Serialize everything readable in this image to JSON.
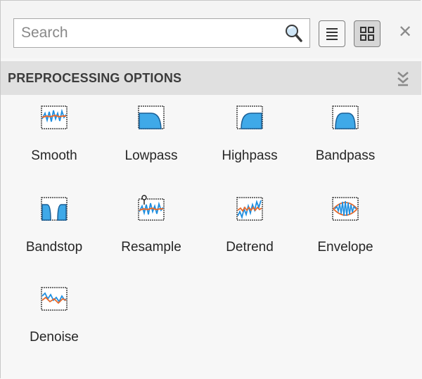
{
  "search": {
    "placeholder": "Search",
    "value": ""
  },
  "toolbar": {
    "list_view_icon": "list-view-icon",
    "grid_view_icon": "grid-view-icon",
    "close_glyph": "✕",
    "active_view": "grid"
  },
  "section": {
    "title": "PREPROCESSING OPTIONS",
    "collapse_icon": "collapse-chevrons-icon"
  },
  "options": [
    {
      "label": "Smooth",
      "icon": "smooth-icon"
    },
    {
      "label": "Lowpass",
      "icon": "lowpass-icon"
    },
    {
      "label": "Highpass",
      "icon": "highpass-icon"
    },
    {
      "label": "Bandpass",
      "icon": "bandpass-icon"
    },
    {
      "label": "Bandstop",
      "icon": "bandstop-icon"
    },
    {
      "label": "Resample",
      "icon": "resample-icon"
    },
    {
      "label": "Detrend",
      "icon": "detrend-icon"
    },
    {
      "label": "Envelope",
      "icon": "envelope-icon"
    },
    {
      "label": "Denoise",
      "icon": "denoise-icon"
    }
  ],
  "colors": {
    "signal_blue": "#1f8fe0",
    "signal_orange": "#e8692a",
    "filter_fill": "#3fa9e8",
    "filter_stroke": "#1a5f96"
  }
}
